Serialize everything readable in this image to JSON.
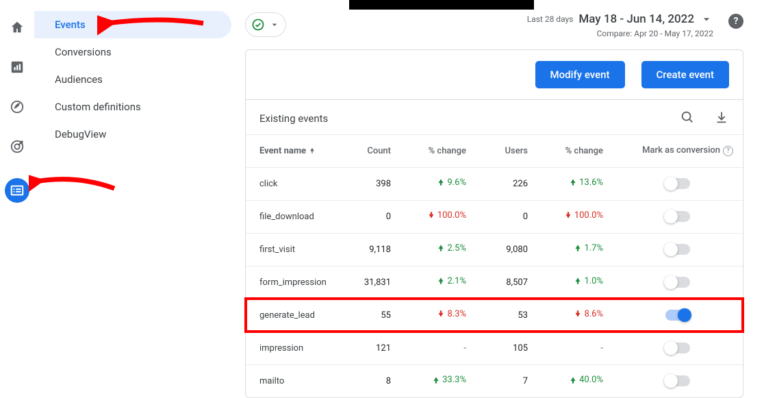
{
  "sidenav": {
    "items": [
      {
        "label": "Events"
      },
      {
        "label": "Conversions"
      },
      {
        "label": "Audiences"
      },
      {
        "label": "Custom definitions"
      },
      {
        "label": "DebugView"
      }
    ]
  },
  "date": {
    "label": "Last 28 days",
    "range": "May 18 - Jun 14, 2022",
    "compare": "Compare: Apr 20 - May 17, 2022"
  },
  "actions": {
    "modify": "Modify event",
    "create": "Create event"
  },
  "table": {
    "title": "Existing events",
    "cols": {
      "name": "Event name",
      "count": "Count",
      "chg1": "% change",
      "users": "Users",
      "chg2": "% change",
      "mark": "Mark as conversion"
    },
    "rows": [
      {
        "name": "click",
        "count": "398",
        "chg1": {
          "dir": "up",
          "val": "9.6%"
        },
        "users": "226",
        "chg2": {
          "dir": "up",
          "val": "13.6%"
        },
        "on": false,
        "hl": false
      },
      {
        "name": "file_download",
        "count": "0",
        "chg1": {
          "dir": "dn",
          "val": "100.0%"
        },
        "users": "0",
        "chg2": {
          "dir": "dn",
          "val": "100.0%"
        },
        "on": false,
        "hl": false
      },
      {
        "name": "first_visit",
        "count": "9,118",
        "chg1": {
          "dir": "up",
          "val": "2.5%"
        },
        "users": "9,080",
        "chg2": {
          "dir": "up",
          "val": "1.7%"
        },
        "on": false,
        "hl": false
      },
      {
        "name": "form_impression",
        "count": "31,831",
        "chg1": {
          "dir": "up",
          "val": "2.1%"
        },
        "users": "8,507",
        "chg2": {
          "dir": "up",
          "val": "1.0%"
        },
        "on": false,
        "hl": false
      },
      {
        "name": "generate_lead",
        "count": "55",
        "chg1": {
          "dir": "dn",
          "val": "8.3%"
        },
        "users": "53",
        "chg2": {
          "dir": "dn",
          "val": "8.6%"
        },
        "on": true,
        "hl": true
      },
      {
        "name": "impression",
        "count": "121",
        "chg1": {
          "dir": "none",
          "val": "-"
        },
        "users": "105",
        "chg2": {
          "dir": "none",
          "val": "-"
        },
        "on": false,
        "hl": false
      },
      {
        "name": "mailto",
        "count": "8",
        "chg1": {
          "dir": "up",
          "val": "33.3%"
        },
        "users": "7",
        "chg2": {
          "dir": "up",
          "val": "40.0%"
        },
        "on": false,
        "hl": false
      }
    ]
  }
}
